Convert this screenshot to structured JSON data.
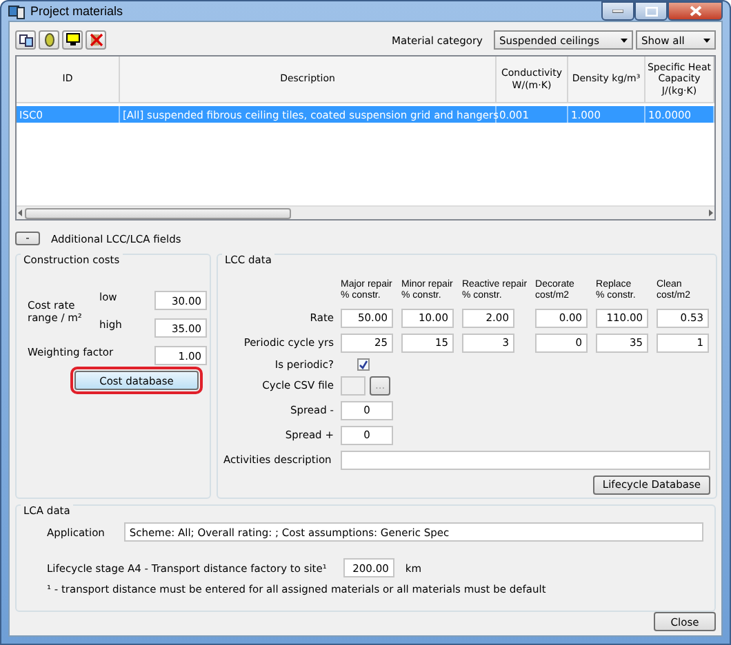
{
  "window": {
    "title": "Project materials"
  },
  "filters": {
    "category_label": "Material category",
    "category": "Suspended ceilings",
    "show": "Show all"
  },
  "table": {
    "columns": [
      "ID",
      "Description",
      "Conductivity\nW/(m·K)",
      "Density kg/m³",
      "Specific Heat\nCapacity\nJ/(kg·K)"
    ],
    "rows": [
      {
        "selected": true,
        "cells": [
          "ISC0",
          "[All] suspended fibrous ceiling tiles, coated suspension grid and hangers",
          "0.001",
          "1.000",
          "10.0000"
        ]
      }
    ]
  },
  "expander": {
    "button": "-",
    "label": "Additional LCC/LCA fields"
  },
  "construction_costs": {
    "title": "Construction costs",
    "range_label": "Cost rate range / m²",
    "low_label": "low",
    "low": "30.00",
    "high_label": "high",
    "high": "35.00",
    "weighting_label": "Weighting factor",
    "weighting": "1.00",
    "button": "Cost database",
    "button_highlighted": true
  },
  "lcc": {
    "title": "LCC data",
    "rate_label": "Rate",
    "cycle_label": "Periodic cycle yrs",
    "columns": [
      {
        "header": [
          "Major repair",
          "% constr."
        ],
        "rate": "50.00",
        "cycle": "25"
      },
      {
        "header": [
          "Minor repair",
          "% constr."
        ],
        "rate": "10.00",
        "cycle": "15"
      },
      {
        "header": [
          "Reactive repair",
          "% constr."
        ],
        "rate": "2.00",
        "cycle": "3"
      },
      {
        "header": [
          "Decorate",
          "cost/m2"
        ],
        "rate": "0.00",
        "cycle": "0"
      },
      {
        "header": [
          "Replace",
          "% constr."
        ],
        "rate": "110.00",
        "cycle": "35"
      },
      {
        "header": [
          "Clean",
          "cost/m2"
        ],
        "rate": "0.53",
        "cycle": "1"
      }
    ],
    "periodic_label": "Is periodic?",
    "periodic_checked": true,
    "csv_label": "Cycle CSV file",
    "browse": "...",
    "spread_minus_label": "Spread -",
    "spread_minus": "0",
    "spread_plus_label": "Spread +",
    "spread_plus": "0",
    "activities_label": "Activities description",
    "button": "Lifecycle Database"
  },
  "lca": {
    "title": "LCA data",
    "application_label": "Application",
    "application": "Scheme: All; Overall rating: ; Cost assumptions: Generic Spec",
    "transport_label": "Lifecycle stage A4 - Transport distance factory to site¹",
    "transport": "200.00",
    "unit": "km",
    "footnote": "¹ - transport distance must be entered for all assigned materials or all materials must be default"
  },
  "close": "Close"
}
